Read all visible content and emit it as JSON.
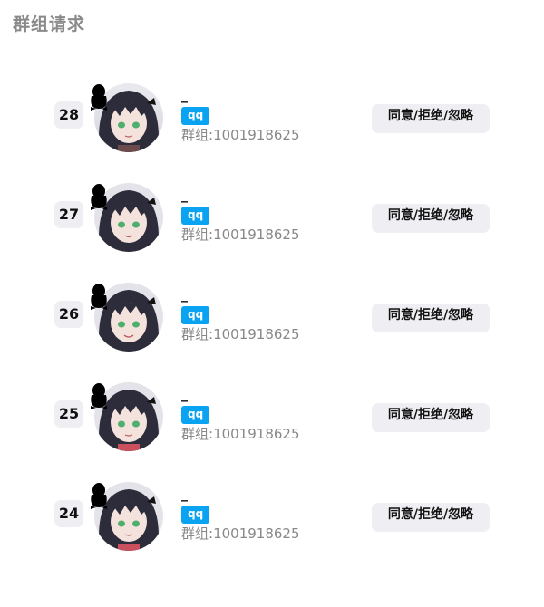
{
  "page": {
    "title": "群组请求"
  },
  "requests": [
    {
      "index": "28",
      "nickname": "_",
      "platform": "qq",
      "group_label": "群组:",
      "group_id": "1001918625",
      "action_label": "同意/拒绝/忽略"
    },
    {
      "index": "27",
      "nickname": "_",
      "platform": "qq",
      "group_label": "群组:",
      "group_id": "1001918625",
      "action_label": "同意/拒绝/忽略"
    },
    {
      "index": "26",
      "nickname": "_",
      "platform": "qq",
      "group_label": "群组:",
      "group_id": "1001918625",
      "action_label": "同意/拒绝/忽略"
    },
    {
      "index": "25",
      "nickname": "_",
      "platform": "qq",
      "group_label": "群组:",
      "group_id": "1001918625",
      "action_label": "同意/拒绝/忽略"
    },
    {
      "index": "24",
      "nickname": "_",
      "platform": "qq",
      "group_label": "群组:",
      "group_id": "1001918625",
      "action_label": "同意/拒绝/忽略"
    }
  ],
  "colors": {
    "title": "#8a8a8a",
    "qq_tag": "#0aa3f1",
    "badge_bg": "#efeff3",
    "secondary_text": "#888888"
  },
  "icons": {
    "avatar": "anime-girl-avatar",
    "platform_badge": "qq-penguin-icon"
  }
}
